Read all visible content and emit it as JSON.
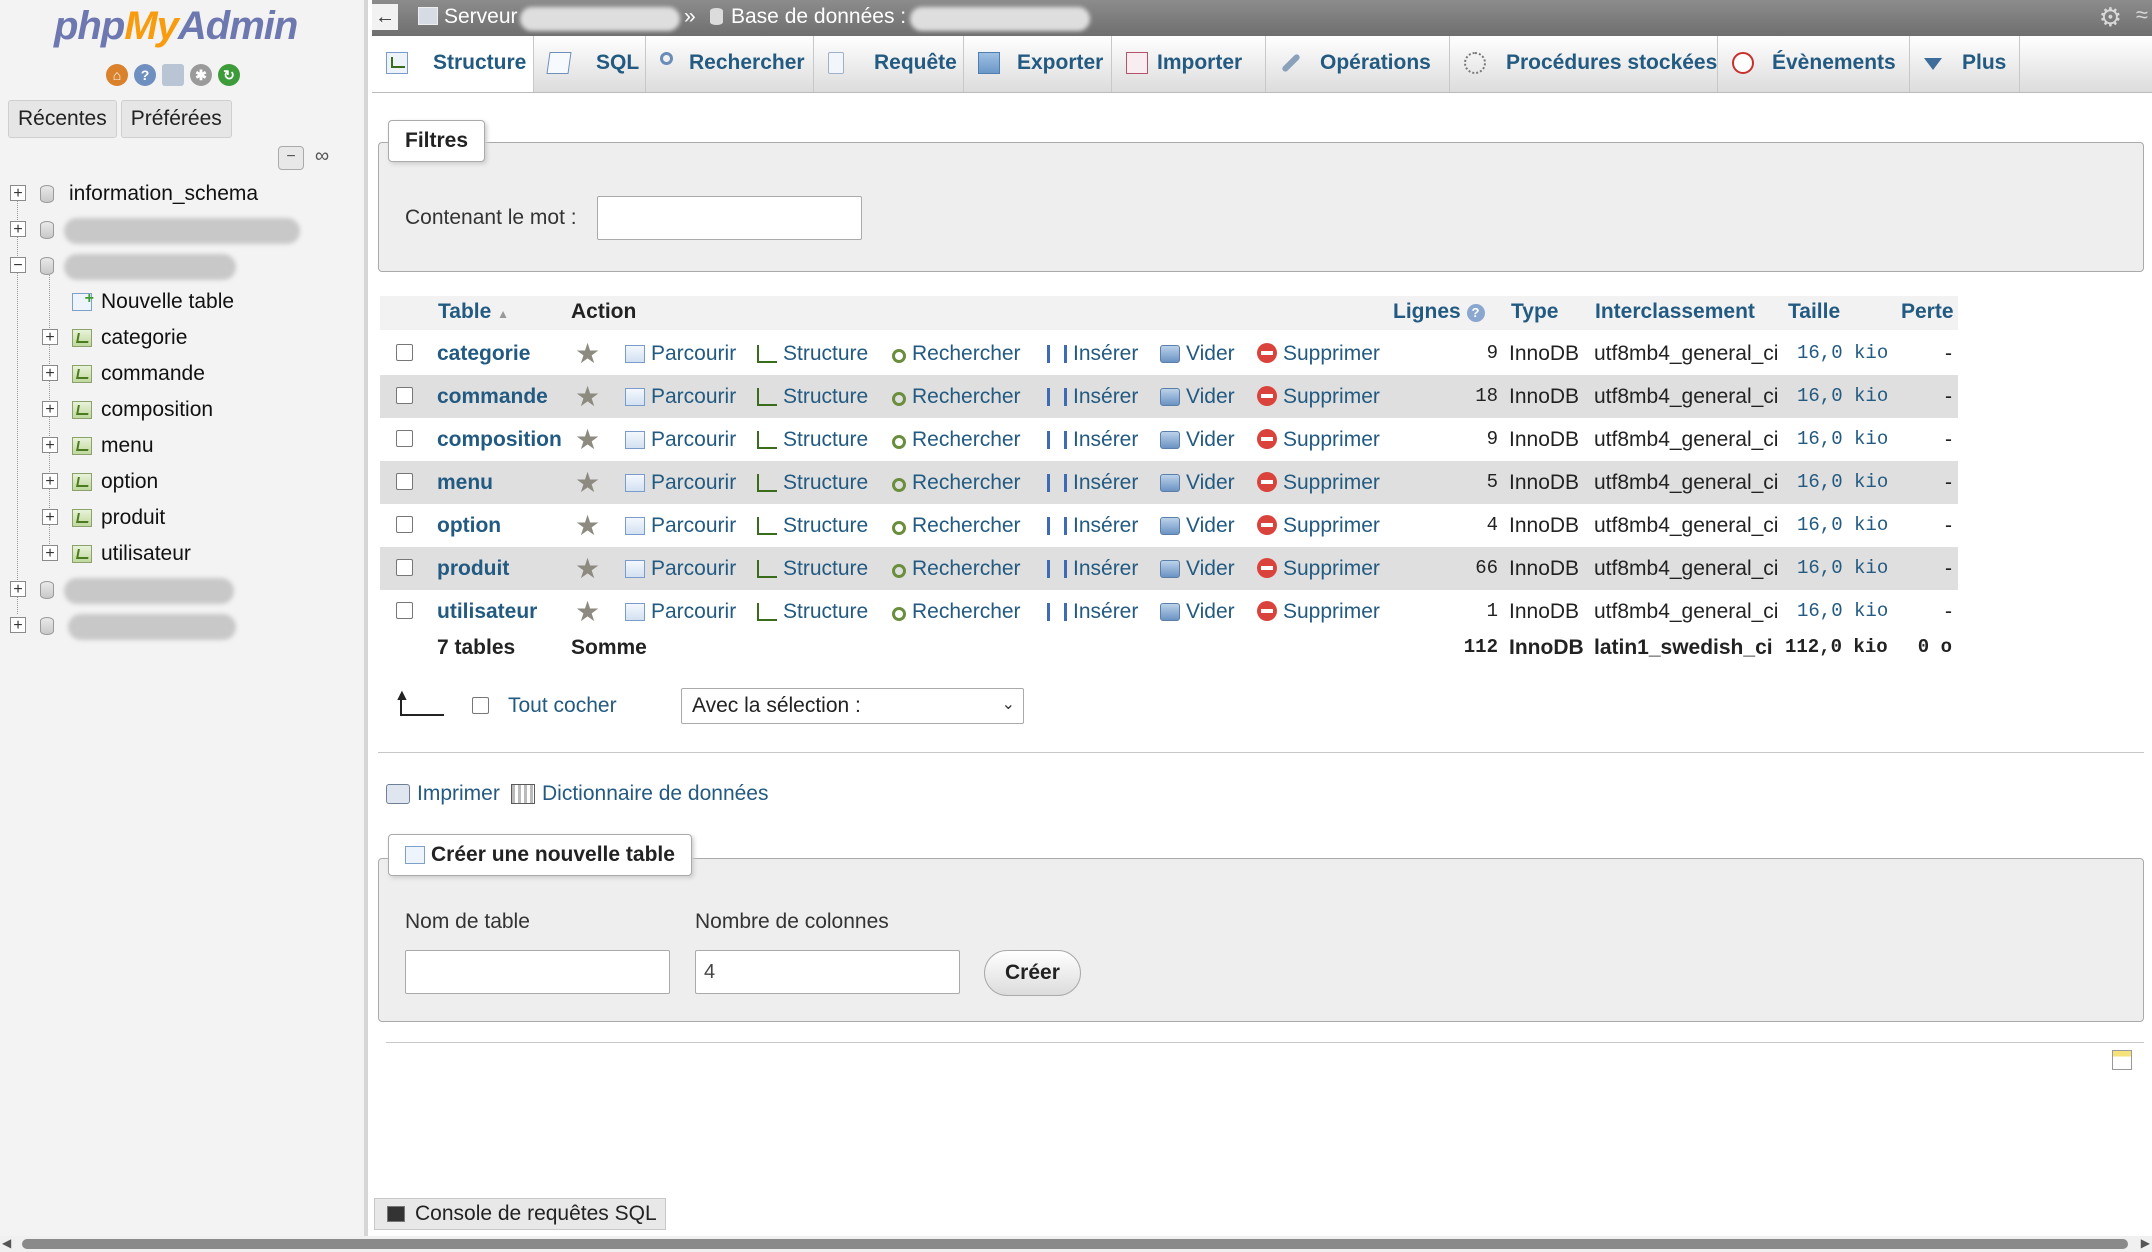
{
  "app": {
    "logo_php": "php",
    "logo_my": "My",
    "logo_admin": "Admin"
  },
  "nav": {
    "tabs": [
      "Récentes",
      "Préférées"
    ],
    "tree": [
      {
        "label": "information_schema",
        "kind": "db",
        "expanded": false
      },
      {
        "label": "",
        "kind": "db",
        "expanded": false,
        "redacted": true
      },
      {
        "label": "",
        "kind": "db",
        "expanded": true,
        "redacted": true
      },
      {
        "label": "Nouvelle table",
        "kind": "new"
      },
      {
        "label": "categorie",
        "kind": "table"
      },
      {
        "label": "commande",
        "kind": "table"
      },
      {
        "label": "composition",
        "kind": "table"
      },
      {
        "label": "menu",
        "kind": "table"
      },
      {
        "label": "option",
        "kind": "table"
      },
      {
        "label": "produit",
        "kind": "table"
      },
      {
        "label": "utilisateur",
        "kind": "table"
      },
      {
        "label": "",
        "kind": "db",
        "expanded": false,
        "redacted": true
      },
      {
        "label": "",
        "kind": "db",
        "expanded": false,
        "redacted": true
      }
    ]
  },
  "topbar": {
    "server_label": "Serveur",
    "separator": "»",
    "db_label": "Base de données :"
  },
  "menu": {
    "tabs": [
      "Structure",
      "SQL",
      "Rechercher",
      "Requête",
      "Exporter",
      "Importer",
      "Opérations",
      "Procédures stockées",
      "Évènements",
      "Plus"
    ],
    "active": "Structure"
  },
  "filters": {
    "legend": "Filtres",
    "label": "Contenant le mot :",
    "value": ""
  },
  "table": {
    "headers": {
      "table": "Table",
      "action": "Action",
      "rows": "Lignes",
      "type": "Type",
      "collation": "Interclassement",
      "size": "Taille",
      "overhead": "Perte"
    },
    "actions": [
      "Parcourir",
      "Structure",
      "Rechercher",
      "Insérer",
      "Vider",
      "Supprimer"
    ],
    "rows": [
      {
        "name": "categorie",
        "rows": "9",
        "type": "InnoDB",
        "collation": "utf8mb4_general_ci",
        "size": "16,0 kio",
        "overhead": "-"
      },
      {
        "name": "commande",
        "rows": "18",
        "type": "InnoDB",
        "collation": "utf8mb4_general_ci",
        "size": "16,0 kio",
        "overhead": "-"
      },
      {
        "name": "composition",
        "rows": "9",
        "type": "InnoDB",
        "collation": "utf8mb4_general_ci",
        "size": "16,0 kio",
        "overhead": "-"
      },
      {
        "name": "menu",
        "rows": "5",
        "type": "InnoDB",
        "collation": "utf8mb4_general_ci",
        "size": "16,0 kio",
        "overhead": "-"
      },
      {
        "name": "option",
        "rows": "4",
        "type": "InnoDB",
        "collation": "utf8mb4_general_ci",
        "size": "16,0 kio",
        "overhead": "-"
      },
      {
        "name": "produit",
        "rows": "66",
        "type": "InnoDB",
        "collation": "utf8mb4_general_ci",
        "size": "16,0 kio",
        "overhead": "-"
      },
      {
        "name": "utilisateur",
        "rows": "1",
        "type": "InnoDB",
        "collation": "utf8mb4_general_ci",
        "size": "16,0 kio",
        "overhead": "-"
      }
    ],
    "summary": {
      "count": "7 tables",
      "label": "Somme",
      "rows": "112",
      "type": "InnoDB",
      "collation": "latin1_swedish_ci",
      "size": "112,0 kio",
      "overhead": "0 o"
    }
  },
  "bulk": {
    "check_all": "Tout cocher",
    "with_selected": "Avec la sélection :"
  },
  "links": {
    "print": "Imprimer",
    "dictionary": "Dictionnaire de données"
  },
  "create": {
    "legend": "Créer une nouvelle table",
    "name_label": "Nom de table",
    "name_value": "",
    "cols_label": "Nombre de colonnes",
    "cols_value": "4",
    "button": "Créer"
  },
  "console": {
    "label": "Console de requêtes SQL"
  }
}
